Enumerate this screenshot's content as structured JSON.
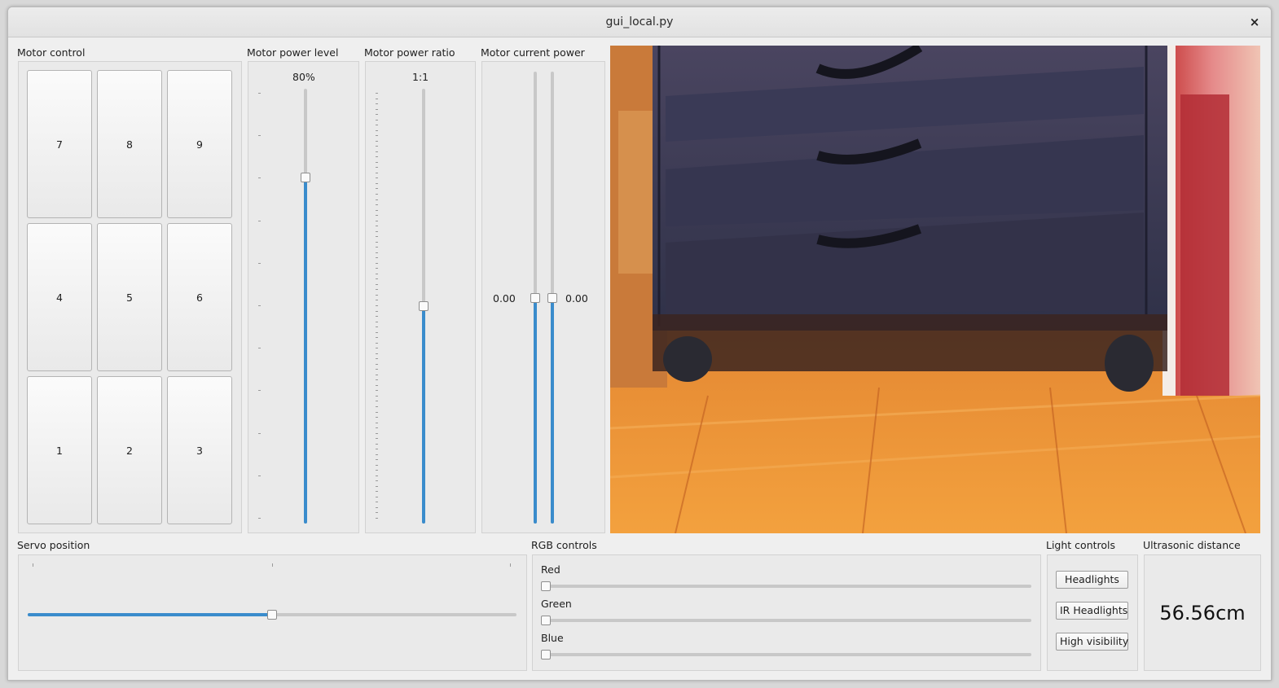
{
  "window": {
    "title": "gui_local.py",
    "close_glyph": "×"
  },
  "motor_control": {
    "label": "Motor control",
    "keys": [
      "7",
      "8",
      "9",
      "4",
      "5",
      "6",
      "1",
      "2",
      "3"
    ]
  },
  "motor_power_level": {
    "label": "Motor power level",
    "value_text": "80%",
    "value": 0.8
  },
  "motor_power_ratio": {
    "label": "Motor power ratio",
    "value_text": "1:1",
    "value": 0.5
  },
  "motor_current_power": {
    "label": "Motor current power",
    "left_text": "0.00",
    "right_text": "0.00",
    "left_value": 0.5,
    "right_value": 0.5
  },
  "servo": {
    "label": "Servo position",
    "value": 0.5
  },
  "rgb": {
    "label": "RGB controls",
    "red_label": "Red",
    "red_value": 0,
    "green_label": "Green",
    "green_value": 0,
    "blue_label": "Blue",
    "blue_value": 0
  },
  "lights": {
    "label": "Light controls",
    "headlights": "Headlights",
    "ir_headlights": "IR Headlights",
    "high_visibility": "High visibility"
  },
  "ultrasonic": {
    "label": "Ultrasonic distance",
    "value": "56.56cm"
  },
  "colors": {
    "accent": "#3a8ccc",
    "window_bg": "#efefef"
  }
}
